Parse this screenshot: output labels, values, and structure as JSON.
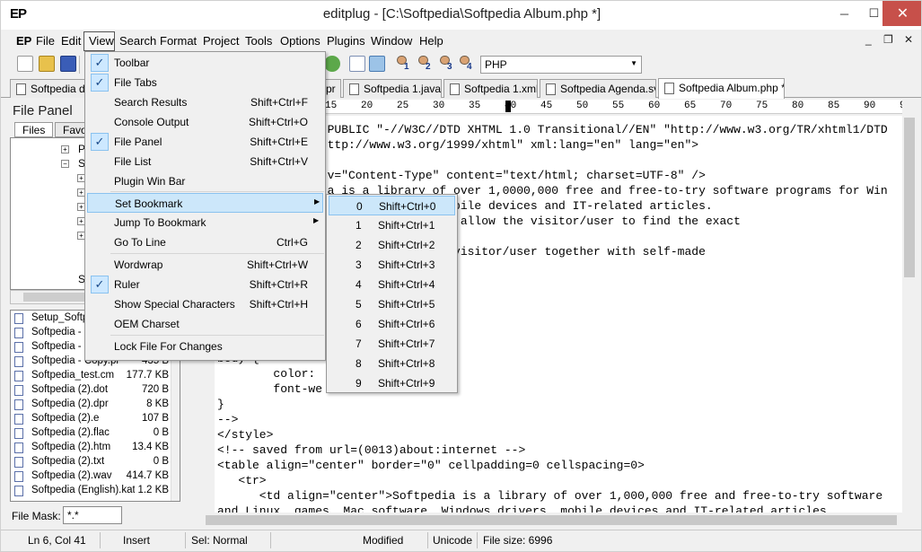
{
  "window": {
    "app_logo": "EP",
    "title": "editplug - [C:\\Softpedia\\Softpedia Album.php *]",
    "min_icon": "─",
    "max_icon": "☐",
    "close_icon": "✕"
  },
  "menubar": {
    "logo": "EP",
    "items": [
      "File",
      "Edit",
      "View",
      "Search",
      "Format",
      "Project",
      "Tools",
      "Options",
      "Plugins",
      "Window",
      "Help"
    ],
    "mdi_min": "_",
    "mdi_restore": "❐",
    "mdi_close": "✕"
  },
  "toolbar": {
    "users": [
      "1",
      "2",
      "3",
      "4"
    ],
    "language": "PHP"
  },
  "tabs": [
    "Softpedia d",
    "pr",
    "Softpedia 1.java",
    "Softpedia 1.xml",
    "Softpedia Agenda.svt",
    "Softpedia Album.php *"
  ],
  "file_panel": {
    "title": "File Panel",
    "tab_files": "Files",
    "tab_favorites": "Favor",
    "tree": [
      "Pr",
      "So",
      "Sy"
    ],
    "files": [
      {
        "name": "Setup_Softp",
        "size": ""
      },
      {
        "name": "Softpedia - b",
        "size": ""
      },
      {
        "name": "Softpedia - C",
        "size": ""
      },
      {
        "name": "Softpedia - Copy.pl",
        "size": "435 B"
      },
      {
        "name": "Softpedia_test.cm",
        "size": "177.7 KB"
      },
      {
        "name": "Softpedia (2).dot",
        "size": "720 B"
      },
      {
        "name": "Softpedia (2).dpr",
        "size": "8 KB"
      },
      {
        "name": "Softpedia (2).e",
        "size": "107 B"
      },
      {
        "name": "Softpedia (2).flac",
        "size": "0 B"
      },
      {
        "name": "Softpedia (2).htm",
        "size": "13.4 KB"
      },
      {
        "name": "Softpedia (2).txt",
        "size": "0 B"
      },
      {
        "name": "Softpedia (2).wav",
        "size": "414.7 KB"
      },
      {
        "name": "Softpedia (English).kat",
        "size": "1.2 KB"
      }
    ],
    "file_mask_label": "File Mask:",
    "file_mask_value": "*.*"
  },
  "ruler": {
    "ticks": [
      "15",
      "20",
      "25",
      "30",
      "35",
      "40",
      "45",
      "50",
      "55",
      "60",
      "65",
      "70",
      "75",
      "80",
      "85",
      "90",
      "95"
    ]
  },
  "editor": {
    "lines": [
      "  PUBLIC \"-//W3C//DTD XHTML 1.0 Transitional//EN\" \"http://www.w3.org/TR/xhtml1/DTD",
      "  ttp://www.w3.org/1999/xhtml\" xml:lang=\"en\" lang=\"en\">",
      "",
      "  v=\"Content-Type\" content=\"text/html; charset=UTF-8\" />",
      "  a is a library of over 1,0000,000 free and free-to-try software programs for Win",
      "  indows drivers, mobile devices and IT-related articles.",
      "  oducts in order to allow the visitor/user to find the exact",
      "  ds.",
      "  t products to the visitor/user together with self-made",
      "  edia</title>",
      "",
      "",
      "",
      "",
      "",
      "",
      "body {",
      "        color:",
      "        font-we",
      "}",
      "-->",
      "</style>",
      "<!-- saved from url=(0013)about:internet -->",
      "<table align=\"center\" border=\"0\" cellpadding=0 cellspacing=0>",
      "   <tr>",
      "      <td align=\"center\">Softpedia is a library of over 1,000,000 free and free-to-try software",
      "and Linux, games, Mac software, Windows drivers, mobile devices and IT-related articles."
    ]
  },
  "view_menu": {
    "items": [
      {
        "label": "Toolbar",
        "shortcut": "",
        "checked": true
      },
      {
        "label": "File Tabs",
        "shortcut": "",
        "checked": true
      },
      {
        "label": "Search Results",
        "shortcut": "Shift+Ctrl+F",
        "checked": false
      },
      {
        "label": "Console Output",
        "shortcut": "Shift+Ctrl+O",
        "checked": false
      },
      {
        "label": "File Panel",
        "shortcut": "Shift+Ctrl+E",
        "checked": true
      },
      {
        "label": "File List",
        "shortcut": "Shift+Ctrl+V",
        "checked": false
      },
      {
        "label": "Plugin Win Bar",
        "shortcut": "",
        "checked": false
      },
      {
        "label": "Set Bookmark",
        "shortcut": "",
        "checked": false
      },
      {
        "label": "Jump To Bookmark",
        "shortcut": "",
        "checked": false
      },
      {
        "label": "Go To Line",
        "shortcut": "Ctrl+G",
        "checked": false
      },
      {
        "label": "Wordwrap",
        "shortcut": "Shift+Ctrl+W",
        "checked": false
      },
      {
        "label": "Ruler",
        "shortcut": "Shift+Ctrl+R",
        "checked": true
      },
      {
        "label": "Show Special Characters",
        "shortcut": "Shift+Ctrl+H",
        "checked": false
      },
      {
        "label": "OEM Charset",
        "shortcut": "",
        "checked": false
      },
      {
        "label": "Lock File For Changes",
        "shortcut": "",
        "checked": false
      }
    ],
    "checkmark": "✓",
    "submenu_arrow": "▶"
  },
  "bookmark_menu": {
    "items": [
      {
        "num": "0",
        "key": "Shift+Ctrl+0"
      },
      {
        "num": "1",
        "key": "Shift+Ctrl+1"
      },
      {
        "num": "2",
        "key": "Shift+Ctrl+2"
      },
      {
        "num": "3",
        "key": "Shift+Ctrl+3"
      },
      {
        "num": "4",
        "key": "Shift+Ctrl+4"
      },
      {
        "num": "5",
        "key": "Shift+Ctrl+5"
      },
      {
        "num": "6",
        "key": "Shift+Ctrl+6"
      },
      {
        "num": "7",
        "key": "Shift+Ctrl+7"
      },
      {
        "num": "8",
        "key": "Shift+Ctrl+8"
      },
      {
        "num": "9",
        "key": "Shift+Ctrl+9"
      }
    ]
  },
  "statusbar": {
    "position": "Ln 6, Col 41",
    "mode": "Insert",
    "selection": "Sel: Normal",
    "modified": "Modified",
    "encoding": "Unicode",
    "file_size": "File size: 6996"
  }
}
